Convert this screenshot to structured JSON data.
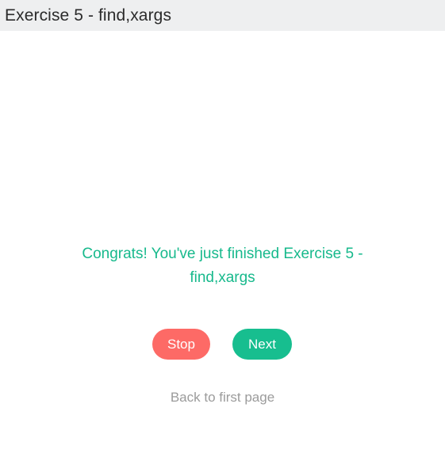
{
  "header": {
    "title": "Exercise 5 - find,xargs"
  },
  "main": {
    "message": "Congrats! You've just finished Exercise 5 - find,xargs",
    "stop_label": "Stop",
    "next_label": "Next",
    "back_link": "Back to first page"
  },
  "colors": {
    "accent": "#17be8f",
    "stop": "#fd6a66",
    "header_bg": "#eeeff0",
    "link": "#9b9b9b"
  }
}
